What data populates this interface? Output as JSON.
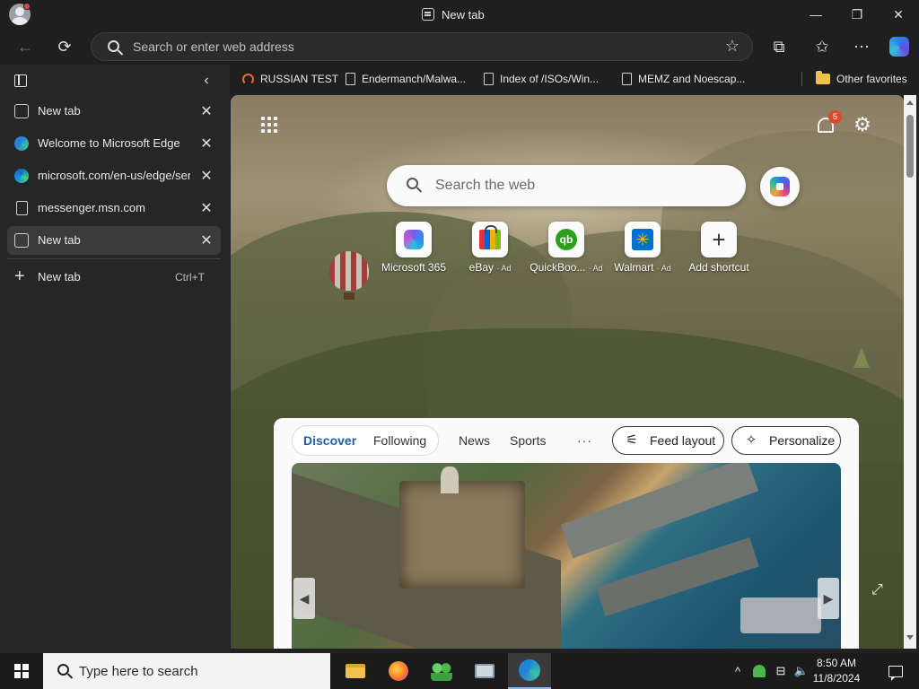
{
  "window": {
    "title": "New tab",
    "controls": {
      "minimize": "—",
      "maximize": "❐",
      "close": "✕"
    }
  },
  "toolbar": {
    "back_icon": "←",
    "refresh_icon": "⟳",
    "address_placeholder": "Search or enter web address",
    "favorite_icon": "☆",
    "extensions_icon": "⧉",
    "favorites_icon": "✩",
    "more_icon": "⋯"
  },
  "favorites_bar": {
    "items": [
      {
        "label": "RUSSIAN TEST",
        "icon": "ring-icon"
      },
      {
        "label": "Endermanch/Malwa...",
        "icon": "doc-icon"
      },
      {
        "label": "Index of /ISOs/Win...",
        "icon": "doc-icon"
      },
      {
        "label": "MEMZ and Noescap...",
        "icon": "doc-icon"
      }
    ],
    "other_favorites": "Other favorites"
  },
  "sidebar": {
    "collapse_icon": "‹",
    "tabs": [
      {
        "label": "New tab",
        "icon": "new-tab-icon",
        "active": false
      },
      {
        "label": "Welcome to Microsoft Edge",
        "icon": "edge-icon",
        "active": false
      },
      {
        "label": "microsoft.com/en-us/edge/server",
        "icon": "edge-icon",
        "active": false
      },
      {
        "label": "messenger.msn.com",
        "icon": "doc-icon",
        "active": false
      },
      {
        "label": "New tab",
        "icon": "new-tab-icon",
        "active": true
      }
    ],
    "close_glyph": "✕",
    "new_tab_label": "New tab",
    "new_tab_shortcut": "Ctrl+T",
    "new_tab_plus": "+"
  },
  "newtab_page": {
    "notification_count": "5",
    "settings_icon": "⚙",
    "search_placeholder": "Search the web",
    "shortcuts": [
      {
        "label": "Microsoft 365",
        "ad": "",
        "icon": "microsoft-365-icon"
      },
      {
        "label": "eBay",
        "ad": "· Ad",
        "icon": "ebay-icon"
      },
      {
        "label": "QuickBoo...",
        "ad": "· Ad",
        "icon": "quickbooks-icon",
        "glyph": "qb"
      },
      {
        "label": "Walmart",
        "ad": "· Ad",
        "icon": "walmart-icon",
        "glyph": "✳"
      },
      {
        "label": "Add shortcut",
        "ad": "",
        "icon": "plus-icon",
        "glyph": "+"
      }
    ],
    "feed": {
      "tabs": [
        "Discover",
        "Following"
      ],
      "links": [
        "News",
        "Sports"
      ],
      "more": "···",
      "feed_layout": "Feed layout",
      "feed_layout_icon": "⚟",
      "personalize": "Personalize",
      "personalize_icon": "✧",
      "arrow_left": "◀",
      "arrow_right": "▶"
    },
    "expand_icon": "⤢"
  },
  "taskbar": {
    "search_placeholder": "Type here to search",
    "apps": [
      "file-explorer-icon",
      "firefox-icon",
      "people-icon",
      "this-pc-icon",
      "edge-icon"
    ],
    "tray": {
      "chevron": "^",
      "volume": "🔈",
      "network": "⊟"
    },
    "time": "8:50 AM",
    "date": "11/8/2024"
  },
  "colors": {
    "chrome_bg": "#1f1f1f",
    "sidebar_bg": "#262626",
    "accent_blue": "#1f5fa8",
    "badge_red": "#d94b2b"
  }
}
